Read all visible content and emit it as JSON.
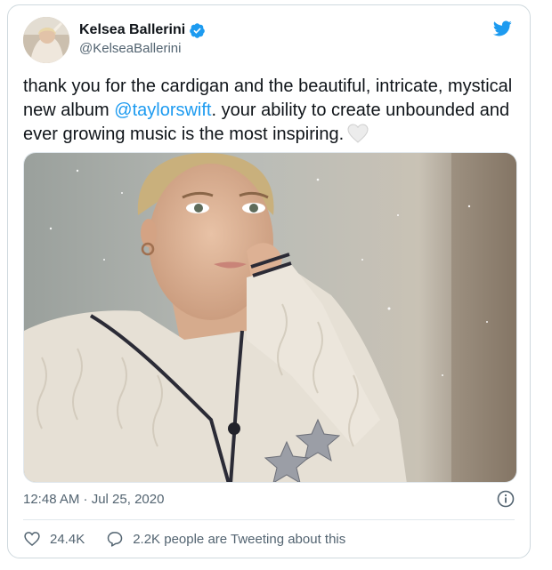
{
  "tweet": {
    "author_name": "Kelsea Ballerini",
    "author_handle": "@KelseaBallerini",
    "text_before": "thank you for the cardigan and the beautiful, intricate, mystical new album ",
    "mention": "@taylorswift",
    "text_after": ". your ability to create unbounded and ever growing music is the most inspiring.",
    "emoji": "white-heart-icon",
    "timestamp": "12:48 AM · Jul 25, 2020",
    "like_count": "24.4K",
    "conversation_text": "2.2K people are Tweeting about this"
  },
  "icons": {
    "verified": "verified-badge-icon",
    "brand": "twitter-bird-icon",
    "info": "info-icon",
    "like": "heart-outline-icon",
    "reply": "speech-bubble-icon"
  },
  "colors": {
    "brand": "#1d9bf0",
    "text": "#0f1419",
    "secondary_text": "#536471",
    "border": "#cfd9de"
  }
}
